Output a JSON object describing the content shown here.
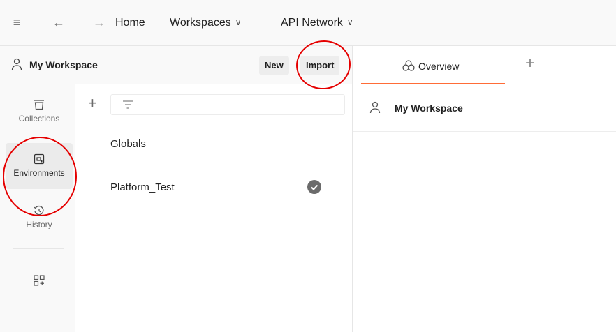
{
  "header": {
    "home": "Home",
    "workspaces": "Workspaces",
    "api_network": "API Network"
  },
  "workspace": {
    "name": "My Workspace",
    "new_label": "New",
    "import_label": "Import"
  },
  "sidebar": {
    "items": [
      {
        "label": "Collections",
        "icon": "collections-icon"
      },
      {
        "label": "Environments",
        "icon": "environments-icon"
      },
      {
        "label": "History",
        "icon": "history-icon"
      },
      {
        "label": "",
        "icon": "add-widget-icon"
      }
    ]
  },
  "environments": [
    {
      "label": "Globals",
      "active": false
    },
    {
      "label": "Platform_Test",
      "active": true
    }
  ],
  "tabs": {
    "overview": "Overview"
  },
  "content": {
    "title": "My Workspace"
  },
  "colors": {
    "accent": "#ff6c37",
    "annotation": "#e50000"
  }
}
